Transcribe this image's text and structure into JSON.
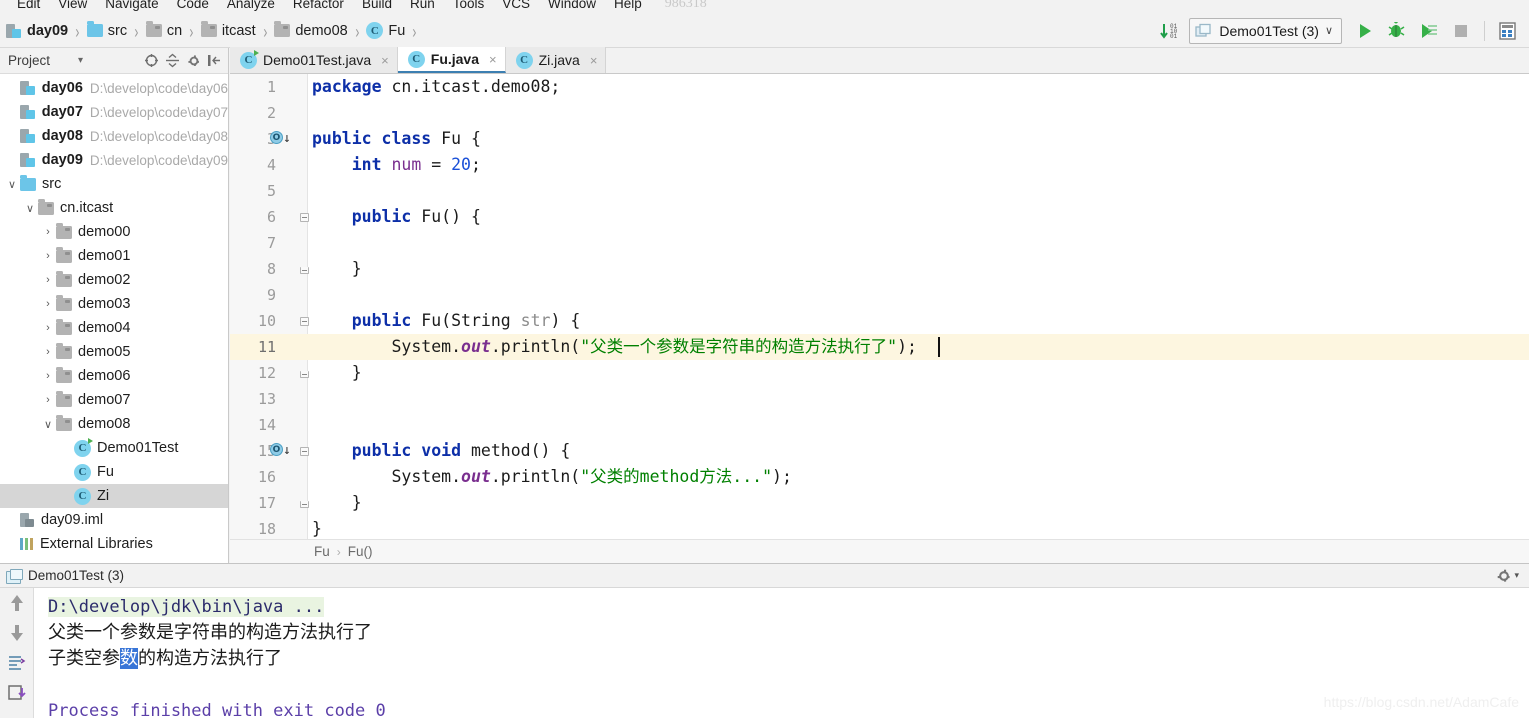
{
  "menu": {
    "items": [
      "Edit",
      "View",
      "Navigate",
      "Code",
      "Analyze",
      "Refactor",
      "Build",
      "Run",
      "Tools",
      "VCS",
      "Window",
      "Help"
    ],
    "page_code": "986318"
  },
  "breadcrumb_nav": {
    "items": [
      {
        "label": "day09",
        "icon": "module-icon",
        "bold": true
      },
      {
        "label": "src",
        "icon": "folder-blue-icon",
        "bold": false
      },
      {
        "label": "cn",
        "icon": "folder-grey-icon",
        "bold": false
      },
      {
        "label": "itcast",
        "icon": "folder-grey-icon",
        "bold": false
      },
      {
        "label": "demo08",
        "icon": "folder-grey-icon",
        "bold": false
      },
      {
        "label": "Fu",
        "icon": "class-icon",
        "bold": false
      }
    ],
    "separator": "›"
  },
  "toolbar": {
    "sort_icon": "sort-numeric-icon",
    "run_config": "Demo01Test (3)",
    "run_config_dropdown": "∨",
    "run_button": "run-icon",
    "debug_button": "debug-icon",
    "coverage_button": "run-with-coverage-icon",
    "stop_button": "stop-icon",
    "layout_button": "project-structure-icon"
  },
  "project_panel": {
    "title": "Project",
    "title_dropdown": "▾",
    "tools": [
      "collapse-target-icon",
      "expand-collapse-icon",
      "settings-icon",
      "hide-icon"
    ],
    "tree": [
      {
        "label": "day06",
        "path": "D:\\develop\\code\\day06",
        "icon": "module-icon",
        "indent": 1,
        "arrow": "",
        "bold": true,
        "selected": false
      },
      {
        "label": "day07",
        "path": "D:\\develop\\code\\day07",
        "icon": "module-icon",
        "indent": 1,
        "arrow": "",
        "bold": true,
        "selected": false
      },
      {
        "label": "day08",
        "path": "D:\\develop\\code\\day08",
        "icon": "module-icon",
        "indent": 1,
        "arrow": "",
        "bold": true,
        "selected": false
      },
      {
        "label": "day09",
        "path": "D:\\develop\\code\\day09",
        "icon": "module-icon",
        "indent": 1,
        "arrow": "",
        "bold": true,
        "selected": false
      },
      {
        "label": "src",
        "path": "",
        "icon": "folder-blue-icon",
        "indent": 1,
        "arrow": "∨",
        "bold": false,
        "selected": false
      },
      {
        "label": "cn.itcast",
        "path": "",
        "icon": "folder-grey-icon",
        "indent": 2,
        "arrow": "∨",
        "bold": false,
        "selected": false
      },
      {
        "label": "demo00",
        "path": "",
        "icon": "folder-grey-icon",
        "indent": 3,
        "arrow": "›",
        "bold": false,
        "selected": false
      },
      {
        "label": "demo01",
        "path": "",
        "icon": "folder-grey-icon",
        "indent": 3,
        "arrow": "›",
        "bold": false,
        "selected": false
      },
      {
        "label": "demo02",
        "path": "",
        "icon": "folder-grey-icon",
        "indent": 3,
        "arrow": "›",
        "bold": false,
        "selected": false
      },
      {
        "label": "demo03",
        "path": "",
        "icon": "folder-grey-icon",
        "indent": 3,
        "arrow": "›",
        "bold": false,
        "selected": false
      },
      {
        "label": "demo04",
        "path": "",
        "icon": "folder-grey-icon",
        "indent": 3,
        "arrow": "›",
        "bold": false,
        "selected": false
      },
      {
        "label": "demo05",
        "path": "",
        "icon": "folder-grey-icon",
        "indent": 3,
        "arrow": "›",
        "bold": false,
        "selected": false
      },
      {
        "label": "demo06",
        "path": "",
        "icon": "folder-grey-icon",
        "indent": 3,
        "arrow": "›",
        "bold": false,
        "selected": false
      },
      {
        "label": "demo07",
        "path": "",
        "icon": "folder-grey-icon",
        "indent": 3,
        "arrow": "›",
        "bold": false,
        "selected": false
      },
      {
        "label": "demo08",
        "path": "",
        "icon": "folder-grey-icon",
        "indent": 3,
        "arrow": "∨",
        "bold": false,
        "selected": false
      },
      {
        "label": "Demo01Test",
        "path": "",
        "icon": "runnable-class-icon",
        "indent": 4,
        "arrow": "",
        "bold": false,
        "selected": false
      },
      {
        "label": "Fu",
        "path": "",
        "icon": "class-icon",
        "indent": 4,
        "arrow": "",
        "bold": false,
        "selected": false
      },
      {
        "label": "Zi",
        "path": "",
        "icon": "class-icon",
        "indent": 4,
        "arrow": "",
        "bold": false,
        "selected": true
      },
      {
        "label": "day09.iml",
        "path": "",
        "icon": "iml-file-icon",
        "indent": 1,
        "arrow": "",
        "bold": false,
        "selected": false
      },
      {
        "label": "External Libraries",
        "path": "",
        "icon": "external-libraries-icon",
        "indent": 0,
        "arrow": "",
        "bold": false,
        "selected": false
      }
    ]
  },
  "editor": {
    "tabs": [
      {
        "label": "Demo01Test.java",
        "icon": "runnable-class-icon",
        "active": false,
        "close": "×"
      },
      {
        "label": "Fu.java",
        "icon": "class-icon",
        "active": true,
        "close": "×"
      },
      {
        "label": "Zi.java",
        "icon": "class-icon",
        "active": false,
        "close": "×"
      }
    ],
    "breadcrumb": [
      "Fu",
      "Fu()"
    ],
    "breadcrumb_sep": "›",
    "lines": [
      {
        "n": "1",
        "current": false,
        "fold": "",
        "marker": "",
        "tokens": [
          {
            "t": "package ",
            "c": "kw"
          },
          {
            "t": "cn.itcast.demo08;",
            "c": "cls"
          }
        ]
      },
      {
        "n": "2",
        "current": false,
        "fold": "",
        "marker": "",
        "tokens": []
      },
      {
        "n": "3",
        "current": false,
        "fold": "",
        "marker": "implemented-by",
        "tokens": [
          {
            "t": "public class ",
            "c": "kw"
          },
          {
            "t": "Fu {",
            "c": "cls"
          }
        ]
      },
      {
        "n": "4",
        "current": false,
        "fold": "",
        "marker": "",
        "tokens": [
          {
            "t": "    ",
            "c": "cls"
          },
          {
            "t": "int ",
            "c": "kw"
          },
          {
            "t": "num",
            "c": "fld"
          },
          {
            "t": " = ",
            "c": "cls"
          },
          {
            "t": "20",
            "c": "num"
          },
          {
            "t": ";",
            "c": "cls"
          }
        ]
      },
      {
        "n": "5",
        "current": false,
        "fold": "",
        "marker": "",
        "tokens": []
      },
      {
        "n": "6",
        "current": false,
        "fold": "start",
        "marker": "",
        "tokens": [
          {
            "t": "    ",
            "c": "cls"
          },
          {
            "t": "public ",
            "c": "kw"
          },
          {
            "t": "Fu() {",
            "c": "cls"
          }
        ]
      },
      {
        "n": "7",
        "current": false,
        "fold": "",
        "marker": "",
        "tokens": []
      },
      {
        "n": "8",
        "current": false,
        "fold": "end",
        "marker": "",
        "tokens": [
          {
            "t": "    }",
            "c": "cls"
          }
        ]
      },
      {
        "n": "9",
        "current": false,
        "fold": "",
        "marker": "",
        "tokens": []
      },
      {
        "n": "10",
        "current": false,
        "fold": "start",
        "marker": "",
        "tokens": [
          {
            "t": "    ",
            "c": "cls"
          },
          {
            "t": "public ",
            "c": "kw"
          },
          {
            "t": "Fu(String ",
            "c": "cls"
          },
          {
            "t": "str",
            "c": "param"
          },
          {
            "t": ") {",
            "c": "cls"
          }
        ]
      },
      {
        "n": "11",
        "current": true,
        "fold": "",
        "marker": "",
        "tokens": [
          {
            "t": "        System.",
            "c": "cls"
          },
          {
            "t": "out",
            "c": "sout"
          },
          {
            "t": ".println(",
            "c": "cls"
          },
          {
            "t": "\"父类一个参数是字符串的构造方法执行了\"",
            "c": "str"
          },
          {
            "t": ");",
            "c": "cls"
          }
        ]
      },
      {
        "n": "12",
        "current": false,
        "fold": "end",
        "marker": "",
        "tokens": [
          {
            "t": "    }",
            "c": "cls"
          }
        ]
      },
      {
        "n": "13",
        "current": false,
        "fold": "",
        "marker": "",
        "tokens": []
      },
      {
        "n": "14",
        "current": false,
        "fold": "",
        "marker": "",
        "tokens": []
      },
      {
        "n": "15",
        "current": false,
        "fold": "start",
        "marker": "implemented-by",
        "tokens": [
          {
            "t": "    ",
            "c": "cls"
          },
          {
            "t": "public void ",
            "c": "kw"
          },
          {
            "t": "method() {",
            "c": "cls"
          }
        ]
      },
      {
        "n": "16",
        "current": false,
        "fold": "",
        "marker": "",
        "tokens": [
          {
            "t": "        System.",
            "c": "cls"
          },
          {
            "t": "out",
            "c": "sout"
          },
          {
            "t": ".println(",
            "c": "cls"
          },
          {
            "t": "\"父类的method方法...\"",
            "c": "str"
          },
          {
            "t": ");",
            "c": "cls"
          }
        ]
      },
      {
        "n": "17",
        "current": false,
        "fold": "end",
        "marker": "",
        "tokens": [
          {
            "t": "    }",
            "c": "cls"
          }
        ]
      },
      {
        "n": "18",
        "current": false,
        "fold": "",
        "marker": "",
        "tokens": [
          {
            "t": "}",
            "c": "cls"
          }
        ]
      }
    ]
  },
  "console": {
    "tab_label": "Demo01Test (3)",
    "tab_icon": "run-tab-icon",
    "settings_icon": "gear-icon",
    "side_icons": [
      "scroll-up-icon",
      "scroll-down-icon",
      "soft-wrap-icon",
      "print-icon"
    ],
    "lines": [
      {
        "text": "D:\\develop\\jdk\\bin\\java ...",
        "style": "cmd"
      },
      {
        "text": "父类一个参数是字符串的构造方法执行了",
        "style": "cn"
      },
      {
        "text": "子类空参",
        "style": "cn",
        "sel": "数",
        "after": "的构造方法执行了"
      },
      {
        "text": "",
        "style": "blank"
      },
      {
        "text": "Process finished with exit code 0",
        "style": "done"
      }
    ]
  },
  "watermark": "https://blog.csdn.net/AdamCafe"
}
